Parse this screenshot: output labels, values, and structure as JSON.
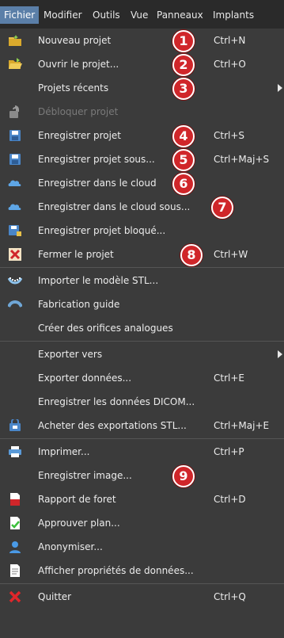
{
  "menubar": {
    "items": [
      "Fichier",
      "Modifier",
      "Outils",
      "Vue",
      "Panneaux",
      "Implants"
    ],
    "active": "Fichier"
  },
  "menu": {
    "items": [
      {
        "label": "Nouveau projet",
        "shortcut": "Ctrl+N",
        "icon": "new-project-folder-icon",
        "badge": "1"
      },
      {
        "label": "Ouvrir le projet...",
        "shortcut": "Ctrl+O",
        "icon": "open-folder-icon",
        "badge": "2"
      },
      {
        "label": "Projets récents",
        "shortcut": "",
        "icon": "",
        "badge": "3",
        "submenu": true
      },
      {
        "label": "Débloquer projet",
        "shortcut": "",
        "icon": "unlock-icon",
        "badge": "",
        "disabled": true
      },
      {
        "label": "Enregistrer projet",
        "shortcut": "Ctrl+S",
        "icon": "save-icon",
        "badge": "4"
      },
      {
        "label": "Enregistrer projet sous...",
        "shortcut": "Ctrl+Maj+S",
        "icon": "save-as-icon",
        "badge": "5"
      },
      {
        "label": "Enregistrer dans le cloud",
        "shortcut": "",
        "icon": "cloud-save-icon",
        "badge": "6"
      },
      {
        "label": "Enregistrer dans le cloud sous...",
        "shortcut": "",
        "icon": "cloud-save-as-icon",
        "badge": "7"
      },
      {
        "label": "Enregistrer projet bloqué...",
        "shortcut": "",
        "icon": "save-locked-icon",
        "badge": ""
      },
      {
        "label": "Fermer le projet",
        "shortcut": "Ctrl+W",
        "icon": "close-project-icon",
        "badge": "8"
      },
      {
        "label": "Importer le modèle STL...",
        "shortcut": "",
        "icon": "import-stl-icon",
        "badge": ""
      },
      {
        "label": "Fabrication guide",
        "shortcut": "",
        "icon": "guide-fabrication-icon",
        "badge": ""
      },
      {
        "label": "Créer des orifices analogues",
        "shortcut": "",
        "icon": "",
        "badge": ""
      },
      {
        "label": "Exporter vers",
        "shortcut": "",
        "icon": "",
        "badge": "",
        "submenu": true
      },
      {
        "label": "Exporter données...",
        "shortcut": "Ctrl+E",
        "icon": "",
        "badge": ""
      },
      {
        "label": "Enregistrer les données DICOM...",
        "shortcut": "",
        "icon": "",
        "badge": ""
      },
      {
        "label": "Acheter des exportations STL...",
        "shortcut": "Ctrl+Maj+E",
        "icon": "buy-export-icon",
        "badge": ""
      },
      {
        "label": "Imprimer...",
        "shortcut": "Ctrl+P",
        "icon": "printer-icon",
        "badge": ""
      },
      {
        "label": "Enregistrer image...",
        "shortcut": "",
        "icon": "",
        "badge": "9"
      },
      {
        "label": "Rapport de foret",
        "shortcut": "Ctrl+D",
        "icon": "drill-report-icon",
        "badge": ""
      },
      {
        "label": "Approuver plan...",
        "shortcut": "",
        "icon": "approve-plan-icon",
        "badge": ""
      },
      {
        "label": "Anonymiser...",
        "shortcut": "",
        "icon": "anonymize-user-icon",
        "badge": ""
      },
      {
        "label": "Afficher propriétés de données...",
        "shortcut": "",
        "icon": "data-properties-icon",
        "badge": ""
      },
      {
        "label": "Quitter",
        "shortcut": "Ctrl+Q",
        "icon": "quit-icon",
        "badge": ""
      }
    ]
  },
  "colors": {
    "background": "#3b3b3b",
    "menubar": "#2a2a2a",
    "active_menu": "#5b7fa8",
    "badge": "#d0262a"
  }
}
